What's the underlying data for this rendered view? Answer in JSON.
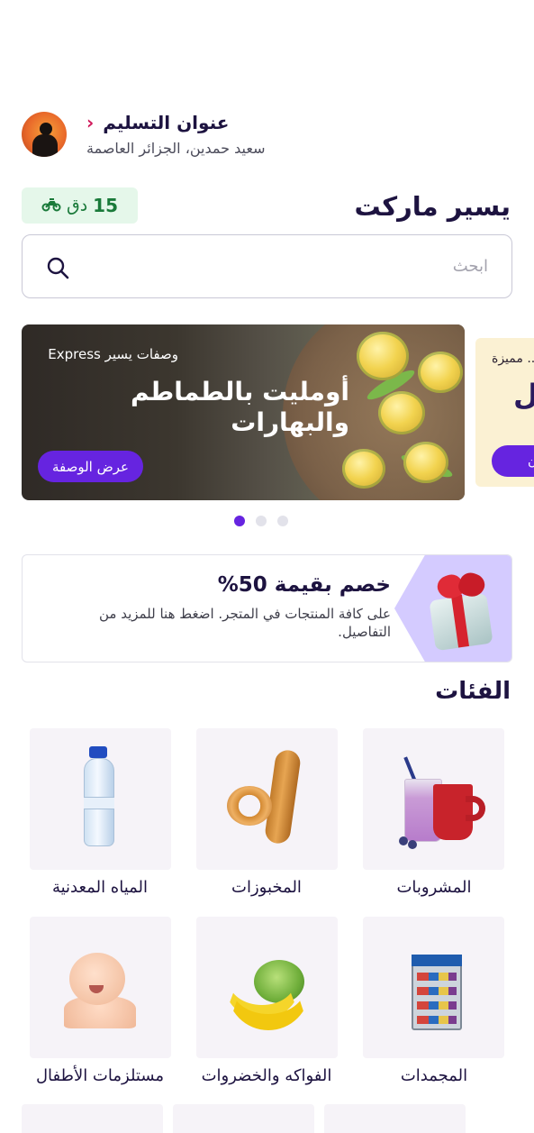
{
  "delivery": {
    "title": "عنوان التسليم",
    "address": "سعيد حمدين، الجزائر العاصمة"
  },
  "brand": {
    "name": "يسير ماركت",
    "eta_value": "15",
    "eta_unit": "دق"
  },
  "search": {
    "placeholder": "ابحث",
    "value": ""
  },
  "carousel": {
    "slides": [
      {
        "tag": "وصفات يسير Express",
        "headline": "أومليت بالطماطم والبهارات",
        "cta": "عرض الوصفة"
      },
      {
        "tag": "... مميزة",
        "headline": "ل",
        "cta": "... الآن"
      }
    ],
    "active_index": 0,
    "count": 3
  },
  "promo": {
    "title": "خصم بقيمة 50%",
    "description": "على كافة المنتجات في المتجر. اضغط هنا للمزيد من التفاصيل."
  },
  "categories": {
    "title": "الفئات",
    "items": [
      {
        "label": "المشروبات",
        "icon": "drinks-icon"
      },
      {
        "label": "المخبوزات",
        "icon": "bakery-icon"
      },
      {
        "label": "المياه المعدنية",
        "icon": "water-bottle-icon"
      },
      {
        "label": "المجمدات",
        "icon": "freezer-icon"
      },
      {
        "label": "الفواكه والخضروات",
        "icon": "banana-icon"
      },
      {
        "label": "مستلزمات الأطفال",
        "icon": "baby-icon"
      }
    ]
  },
  "colors": {
    "primary": "#6624e0",
    "text_dark": "#1d1340",
    "accent_pink": "#d0185a",
    "eta_bg": "#e5f7ea",
    "eta_text": "#1a7a3a",
    "promo_shape": "#d4cbff",
    "tile_bg": "#f6f3f8"
  }
}
